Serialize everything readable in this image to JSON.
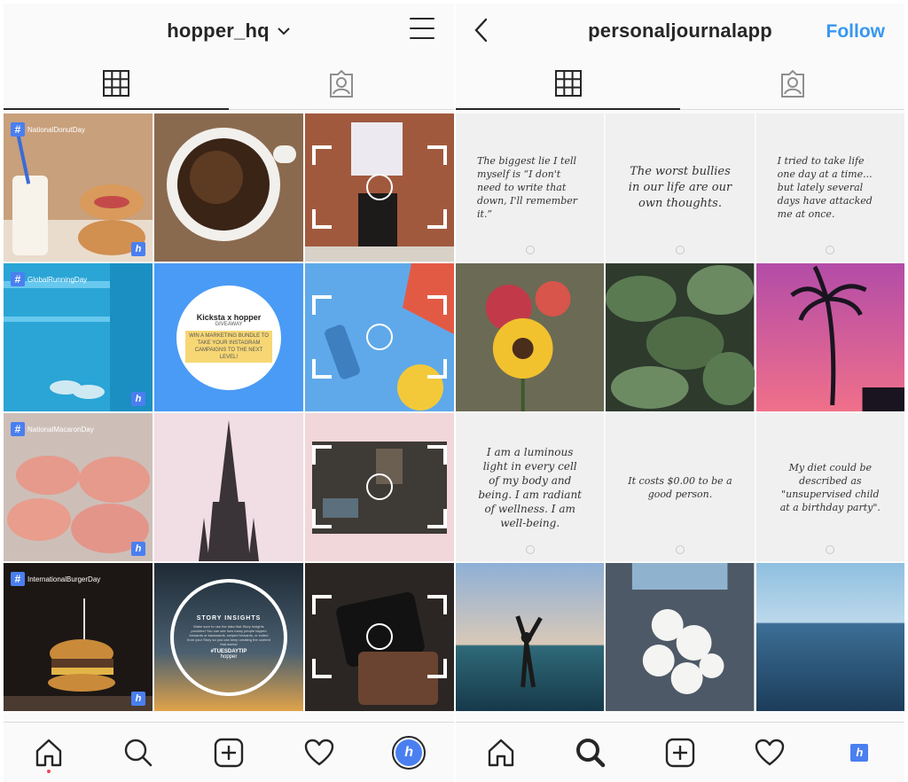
{
  "left": {
    "username": "hopper_hq",
    "hashtags": [
      "NationalDonutDay",
      "GlobalRunningDay",
      "NationalMacaronDay",
      "InternationalBurgerDay"
    ],
    "giveaway": {
      "title": "Kicksta x hopper",
      "subtitle": "GIVEAWAY",
      "body": "WIN A MARKETING BUNDLE TO TAKE YOUR INSTAGRAM CAMPAIGNS TO THE NEXT LEVEL!"
    },
    "story_insights": {
      "title": "STORY INSIGHTS",
      "body": "Make sure to use the data that Story Insights provides! You can see how many people tapped forwards or backwards, swiped forwards, or exited from your Story so you can keep creating the content that works!",
      "tag": "#TUESDAYTIP",
      "brand": "hopper"
    },
    "brand_letter": "h"
  },
  "right": {
    "username": "personaljournalapp",
    "follow_label": "Follow",
    "quotes": [
      "The biggest lie I tell myself is “I don't need to write that down, I'll remember it.”",
      "The worst bullies in our life are our own thoughts.",
      "I tried to take life one day at a time... but lately several days have attacked me at once.",
      "I am a luminous light in every cell of my body and being. I am radiant of wellness. I am well-being.",
      "It costs $0.00 to be a good person.",
      "My diet could be described as \"unsupervised child at a birthday party\"."
    ]
  },
  "colors": {
    "follow": "#3897f0",
    "brand": "#4a7ff0",
    "notification_dot": "#ed4956"
  }
}
